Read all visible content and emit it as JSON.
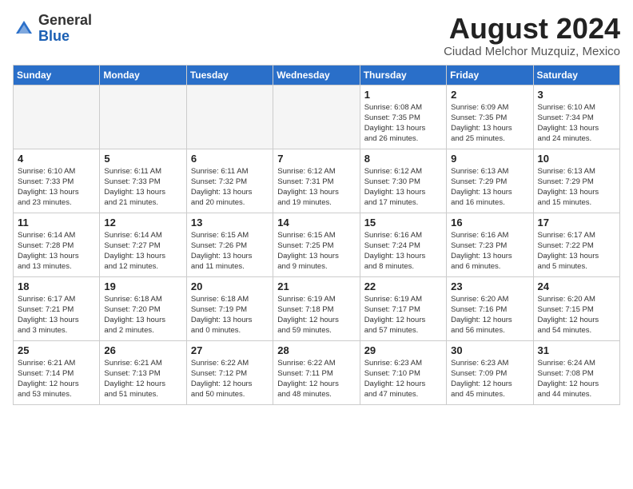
{
  "header": {
    "logo_general": "General",
    "logo_blue": "Blue",
    "title": "August 2024",
    "subtitle": "Ciudad Melchor Muzquiz, Mexico"
  },
  "weekdays": [
    "Sunday",
    "Monday",
    "Tuesday",
    "Wednesday",
    "Thursday",
    "Friday",
    "Saturday"
  ],
  "weeks": [
    [
      {
        "day": "",
        "info": ""
      },
      {
        "day": "",
        "info": ""
      },
      {
        "day": "",
        "info": ""
      },
      {
        "day": "",
        "info": ""
      },
      {
        "day": "1",
        "info": "Sunrise: 6:08 AM\nSunset: 7:35 PM\nDaylight: 13 hours\nand 26 minutes."
      },
      {
        "day": "2",
        "info": "Sunrise: 6:09 AM\nSunset: 7:35 PM\nDaylight: 13 hours\nand 25 minutes."
      },
      {
        "day": "3",
        "info": "Sunrise: 6:10 AM\nSunset: 7:34 PM\nDaylight: 13 hours\nand 24 minutes."
      }
    ],
    [
      {
        "day": "4",
        "info": "Sunrise: 6:10 AM\nSunset: 7:33 PM\nDaylight: 13 hours\nand 23 minutes."
      },
      {
        "day": "5",
        "info": "Sunrise: 6:11 AM\nSunset: 7:33 PM\nDaylight: 13 hours\nand 21 minutes."
      },
      {
        "day": "6",
        "info": "Sunrise: 6:11 AM\nSunset: 7:32 PM\nDaylight: 13 hours\nand 20 minutes."
      },
      {
        "day": "7",
        "info": "Sunrise: 6:12 AM\nSunset: 7:31 PM\nDaylight: 13 hours\nand 19 minutes."
      },
      {
        "day": "8",
        "info": "Sunrise: 6:12 AM\nSunset: 7:30 PM\nDaylight: 13 hours\nand 17 minutes."
      },
      {
        "day": "9",
        "info": "Sunrise: 6:13 AM\nSunset: 7:29 PM\nDaylight: 13 hours\nand 16 minutes."
      },
      {
        "day": "10",
        "info": "Sunrise: 6:13 AM\nSunset: 7:29 PM\nDaylight: 13 hours\nand 15 minutes."
      }
    ],
    [
      {
        "day": "11",
        "info": "Sunrise: 6:14 AM\nSunset: 7:28 PM\nDaylight: 13 hours\nand 13 minutes."
      },
      {
        "day": "12",
        "info": "Sunrise: 6:14 AM\nSunset: 7:27 PM\nDaylight: 13 hours\nand 12 minutes."
      },
      {
        "day": "13",
        "info": "Sunrise: 6:15 AM\nSunset: 7:26 PM\nDaylight: 13 hours\nand 11 minutes."
      },
      {
        "day": "14",
        "info": "Sunrise: 6:15 AM\nSunset: 7:25 PM\nDaylight: 13 hours\nand 9 minutes."
      },
      {
        "day": "15",
        "info": "Sunrise: 6:16 AM\nSunset: 7:24 PM\nDaylight: 13 hours\nand 8 minutes."
      },
      {
        "day": "16",
        "info": "Sunrise: 6:16 AM\nSunset: 7:23 PM\nDaylight: 13 hours\nand 6 minutes."
      },
      {
        "day": "17",
        "info": "Sunrise: 6:17 AM\nSunset: 7:22 PM\nDaylight: 13 hours\nand 5 minutes."
      }
    ],
    [
      {
        "day": "18",
        "info": "Sunrise: 6:17 AM\nSunset: 7:21 PM\nDaylight: 13 hours\nand 3 minutes."
      },
      {
        "day": "19",
        "info": "Sunrise: 6:18 AM\nSunset: 7:20 PM\nDaylight: 13 hours\nand 2 minutes."
      },
      {
        "day": "20",
        "info": "Sunrise: 6:18 AM\nSunset: 7:19 PM\nDaylight: 13 hours\nand 0 minutes."
      },
      {
        "day": "21",
        "info": "Sunrise: 6:19 AM\nSunset: 7:18 PM\nDaylight: 12 hours\nand 59 minutes."
      },
      {
        "day": "22",
        "info": "Sunrise: 6:19 AM\nSunset: 7:17 PM\nDaylight: 12 hours\nand 57 minutes."
      },
      {
        "day": "23",
        "info": "Sunrise: 6:20 AM\nSunset: 7:16 PM\nDaylight: 12 hours\nand 56 minutes."
      },
      {
        "day": "24",
        "info": "Sunrise: 6:20 AM\nSunset: 7:15 PM\nDaylight: 12 hours\nand 54 minutes."
      }
    ],
    [
      {
        "day": "25",
        "info": "Sunrise: 6:21 AM\nSunset: 7:14 PM\nDaylight: 12 hours\nand 53 minutes."
      },
      {
        "day": "26",
        "info": "Sunrise: 6:21 AM\nSunset: 7:13 PM\nDaylight: 12 hours\nand 51 minutes."
      },
      {
        "day": "27",
        "info": "Sunrise: 6:22 AM\nSunset: 7:12 PM\nDaylight: 12 hours\nand 50 minutes."
      },
      {
        "day": "28",
        "info": "Sunrise: 6:22 AM\nSunset: 7:11 PM\nDaylight: 12 hours\nand 48 minutes."
      },
      {
        "day": "29",
        "info": "Sunrise: 6:23 AM\nSunset: 7:10 PM\nDaylight: 12 hours\nand 47 minutes."
      },
      {
        "day": "30",
        "info": "Sunrise: 6:23 AM\nSunset: 7:09 PM\nDaylight: 12 hours\nand 45 minutes."
      },
      {
        "day": "31",
        "info": "Sunrise: 6:24 AM\nSunset: 7:08 PM\nDaylight: 12 hours\nand 44 minutes."
      }
    ]
  ]
}
